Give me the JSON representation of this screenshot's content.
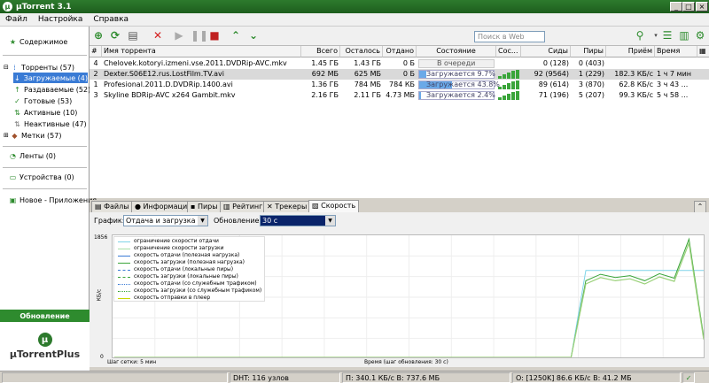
{
  "app": {
    "title": "µTorrent 3.1"
  },
  "menu": [
    "Файл",
    "Настройка",
    "Справка"
  ],
  "sidebar": {
    "items": [
      {
        "label": "Содержимое",
        "icon": "star-icon"
      },
      {
        "label": "Торренты (57)",
        "icon": "torrents-icon"
      },
      {
        "label": "Загружаемые (4)",
        "icon": "download-arrow-icon"
      },
      {
        "label": "Раздаваемые (52)",
        "icon": "upload-arrow-icon"
      },
      {
        "label": "Готовые (53)",
        "icon": "check-icon"
      },
      {
        "label": "Активные (10)",
        "icon": "active-icon"
      },
      {
        "label": "Неактивные (47)",
        "icon": "inactive-icon"
      },
      {
        "label": "Метки (57)",
        "icon": "labels-icon"
      },
      {
        "label": "Ленты (0)",
        "icon": "rss-icon"
      },
      {
        "label": "Устройства (0)",
        "icon": "devices-icon"
      },
      {
        "label": "Новое - Приложения",
        "icon": "apps-icon"
      }
    ],
    "update_label": "Обновление",
    "plus_label": "µTorrentPlus"
  },
  "toolbar": {
    "search_placeholder": "Поиск в Web"
  },
  "table": {
    "columns": [
      "#",
      "Имя торрента",
      "Всего",
      "Осталось",
      "Отдано",
      "Состояние",
      "Сос...",
      "Сиды",
      "Пиры",
      "Приём",
      "Время"
    ],
    "rows": [
      {
        "n": "4",
        "name": "Chelovek.kotoryi.izmeni.vse.2011.DVDRip-AVC.mkv",
        "total": "1.45 ГБ",
        "left": "1.43 ГБ",
        "up": "0 Б",
        "state": "В очереди",
        "pct": 0,
        "seeds": "0 (128)",
        "peers": "0 (403)",
        "rate": "",
        "eta": ""
      },
      {
        "n": "2",
        "name": "Dexter.S06E12.rus.LostFilm.TV.avi",
        "total": "692 МБ",
        "left": "625 МБ",
        "up": "0 Б",
        "state": "Загружается 9.7%",
        "pct": 9.7,
        "seeds": "92 (9564)",
        "peers": "1 (229)",
        "rate": "182.3 КБ/с",
        "eta": "1 ч 7 мин"
      },
      {
        "n": "1",
        "name": "Profesional.2011.D.DVDRip.1400.avi",
        "total": "1.36 ГБ",
        "left": "784 МБ",
        "up": "784 КБ",
        "state": "Загружается 43.8%",
        "pct": 43.8,
        "seeds": "89 (614)",
        "peers": "3 (870)",
        "rate": "62.8 КБ/с",
        "eta": "3 ч 43 ..."
      },
      {
        "n": "3",
        "name": "Skyline BDRip-AVC x264 Gambit.mkv",
        "total": "2.16 ГБ",
        "left": "2.11 ГБ",
        "up": "4.73 МБ",
        "state": "Загружается 2.4%",
        "pct": 2.4,
        "seeds": "71 (196)",
        "peers": "5 (207)",
        "rate": "99.3 КБ/с",
        "eta": "5 ч 58 ..."
      }
    ]
  },
  "tabs": [
    "Файлы",
    "Информация",
    "Пиры",
    "Рейтинги",
    "Трекеры",
    "Скорость"
  ],
  "speed": {
    "graph_label": "График:",
    "graph_value": "Отдача и загрузка",
    "update_label": "Обновление:",
    "update_value": "30 с",
    "ymax": "1856",
    "ymin": "0",
    "yunit": "КБ/с",
    "xlabel_left": "Шаг сетки: 5 мин",
    "xlabel_center": "Время (шаг обновления: 30 с)",
    "legend": [
      {
        "label": "ограничение скорости отдачи",
        "color": "#7fd4e8",
        "dash": "solid"
      },
      {
        "label": "ограничение скорости загрузки",
        "color": "#a8e0a8",
        "dash": "solid"
      },
      {
        "label": "скорость отдачи (полезная нагрузка)",
        "color": "#3a7bd5",
        "dash": "solid"
      },
      {
        "label": "скорость загрузки (полезная нагрузка)",
        "color": "#3aa53a",
        "dash": "solid"
      },
      {
        "label": "скорость отдачи (локальные пиры)",
        "color": "#3a7bd5",
        "dash": "dashed"
      },
      {
        "label": "скорость загрузки (локальные пиры)",
        "color": "#3aa53a",
        "dash": "dashed"
      },
      {
        "label": "скорость отдачи (со служебным трафиком)",
        "color": "#3a7bd5",
        "dash": "dotted"
      },
      {
        "label": "скорость загрузки (со служебным трафиком)",
        "color": "#3aa53a",
        "dash": "dotted"
      },
      {
        "label": "скорость отправки в плеер",
        "color": "#c8d800",
        "dash": "solid"
      }
    ]
  },
  "chart_data": {
    "type": "line",
    "ylim": [
      0,
      1856
    ],
    "ylabel": "КБ/с",
    "xlabel": "Время (шаг обновления: 30 с)",
    "series": [
      {
        "name": "ограничение скорости загрузки",
        "x": [
          0,
          1,
          2,
          3,
          4,
          5,
          6,
          7,
          8,
          9,
          10,
          11,
          12,
          13,
          14,
          15,
          16,
          17,
          18,
          19,
          20,
          21,
          22,
          23,
          24,
          25,
          26,
          27,
          28,
          29,
          30,
          31,
          32,
          33,
          34,
          35,
          36,
          37,
          38,
          39,
          40
        ],
        "values": [
          0,
          0,
          0,
          0,
          0,
          0,
          0,
          0,
          0,
          0,
          0,
          0,
          0,
          0,
          0,
          0,
          0,
          0,
          0,
          0,
          0,
          0,
          0,
          0,
          0,
          0,
          0,
          0,
          0,
          0,
          0,
          0,
          1360,
          1360,
          1360,
          1360,
          1360,
          1360,
          1360,
          1360,
          1360
        ]
      },
      {
        "name": "скорость загрузки (со служебным трафиком)",
        "x": [
          0,
          1,
          2,
          3,
          4,
          5,
          6,
          7,
          8,
          9,
          10,
          11,
          12,
          13,
          14,
          15,
          16,
          17,
          18,
          19,
          20,
          21,
          22,
          23,
          24,
          25,
          26,
          27,
          28,
          29,
          30,
          31,
          32,
          33,
          34,
          35,
          36,
          37,
          38,
          39,
          40
        ],
        "values": [
          0,
          0,
          0,
          0,
          0,
          0,
          0,
          0,
          0,
          0,
          0,
          0,
          0,
          0,
          0,
          0,
          0,
          0,
          0,
          0,
          0,
          0,
          0,
          0,
          0,
          0,
          0,
          0,
          0,
          0,
          0,
          0,
          1200,
          1300,
          1250,
          1280,
          1200,
          1310,
          1240,
          1850,
          320
        ]
      },
      {
        "name": "скорость загрузки (полезная нагрузка)",
        "x": [
          0,
          1,
          2,
          3,
          4,
          5,
          6,
          7,
          8,
          9,
          10,
          11,
          12,
          13,
          14,
          15,
          16,
          17,
          18,
          19,
          20,
          21,
          22,
          23,
          24,
          25,
          26,
          27,
          28,
          29,
          30,
          31,
          32,
          33,
          34,
          35,
          36,
          37,
          38,
          39,
          40
        ],
        "values": [
          0,
          0,
          0,
          0,
          0,
          0,
          0,
          0,
          0,
          0,
          0,
          0,
          0,
          0,
          0,
          0,
          0,
          0,
          0,
          0,
          0,
          0,
          0,
          0,
          0,
          0,
          0,
          0,
          0,
          0,
          0,
          0,
          1150,
          1250,
          1200,
          1230,
          1150,
          1260,
          1190,
          1790,
          280
        ]
      }
    ]
  },
  "status": {
    "dht": "DHT: 116 узлов",
    "download": "П: 340.1 КБ/с В: 737.6 МБ",
    "upload": "О: [1250K] 86.6 КБ/с В: 41.2 МБ"
  }
}
